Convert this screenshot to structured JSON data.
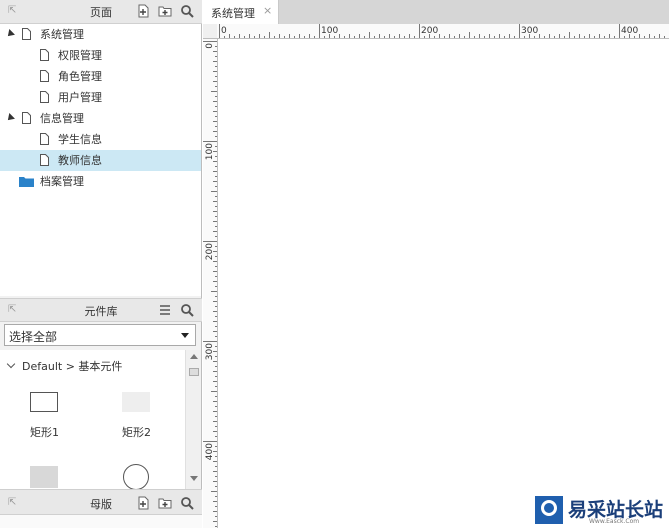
{
  "pages_panel": {
    "title": "页面",
    "tree": [
      {
        "label": "系统管理",
        "kind": "page",
        "expanded": true
      },
      {
        "label": "权限管理",
        "kind": "page"
      },
      {
        "label": "角色管理",
        "kind": "page"
      },
      {
        "label": "用户管理",
        "kind": "page"
      },
      {
        "label": "信息管理",
        "kind": "page",
        "expanded": true
      },
      {
        "label": "学生信息",
        "kind": "page"
      },
      {
        "label": "教师信息",
        "kind": "page",
        "selected": true
      },
      {
        "label": "档案管理",
        "kind": "folder"
      }
    ]
  },
  "widgets_panel": {
    "title": "元件库",
    "library_select": "选择全部",
    "group_title": "Default > 基本元件",
    "widgets": [
      {
        "label": "矩形1"
      },
      {
        "label": "矩形2"
      },
      {
        "label": ""
      },
      {
        "label": ""
      }
    ]
  },
  "masters_panel": {
    "title": "母版"
  },
  "editor": {
    "tab_label": "系统管理",
    "tab_close": "×",
    "h_ruler_labels": [
      "0",
      "100",
      "200",
      "300",
      "400"
    ],
    "v_ruler_labels": [
      "0",
      "100",
      "200",
      "300",
      "400"
    ]
  },
  "watermark": {
    "text": "易采站长站",
    "url": "Www.Easck.Com"
  },
  "colors": {
    "selected_row": "#cce8f4",
    "folder_icon": "#2a82c9",
    "watermark_blue": "#1f5fae"
  }
}
